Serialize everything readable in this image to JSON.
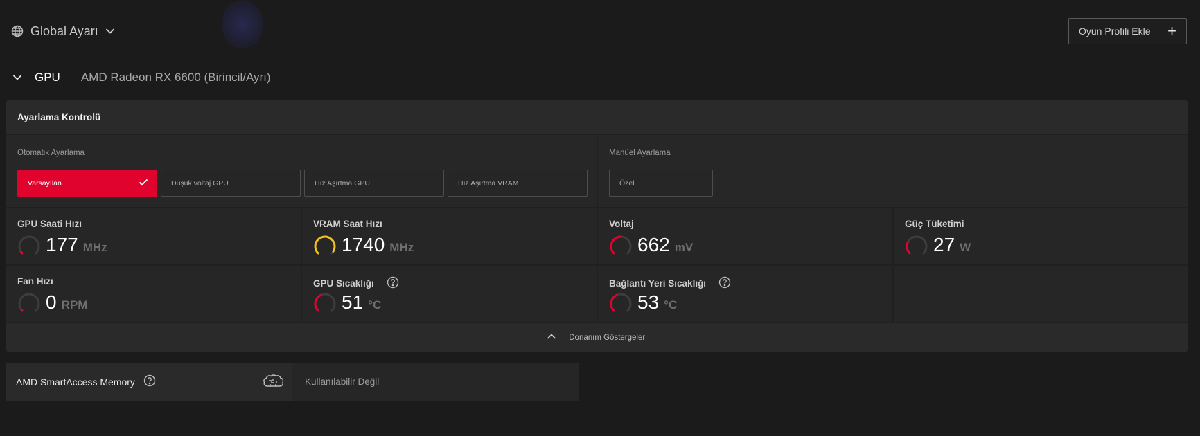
{
  "header": {
    "global_label": "Global Ayarı",
    "add_profile_label": "Oyun Profili Ekle",
    "add_profile_icon": "+"
  },
  "gpu": {
    "label": "GPU",
    "name": "AMD Radeon RX 6600 (Birincil/Ayrı)"
  },
  "tuning": {
    "title": "Ayarlama Kontrolü",
    "auto_label": "Otomatik Ayarlama",
    "manual_label": "Manüel Ayarlama",
    "auto_options": [
      "Varsayılan",
      "Düşük voltaj GPU",
      "Hız Aşırtma GPU",
      "Hız Aşırtma VRAM"
    ],
    "selected_option": "Varsayılan",
    "manual_options": [
      "Özel"
    ]
  },
  "metrics": {
    "gpu_clock": {
      "title": "GPU Saati Hızı",
      "value": "177",
      "unit": "MHz",
      "level": 0.05
    },
    "vram_clock": {
      "title": "VRAM Saat Hızı",
      "value": "1740",
      "unit": "MHz",
      "level": 0.95
    },
    "voltage": {
      "title": "Voltaj",
      "value": "662",
      "unit": "mV",
      "level": 0.5
    },
    "power": {
      "title": "Güç Tüketimi",
      "value": "27",
      "unit": "W",
      "level": 0.25
    },
    "fan": {
      "title": "Fan Hızı",
      "value": "0",
      "unit": "RPM",
      "level": 0
    },
    "gpu_temp": {
      "title": "GPU Sıcaklığı",
      "value": "51",
      "unit": "°C",
      "level": 0.4
    },
    "junction_temp": {
      "title": "Bağlantı Yeri Sıcaklığı",
      "value": "53",
      "unit": "°C",
      "level": 0.4
    }
  },
  "hardware_toggle_label": "Donanım Göstergeleri",
  "smart_access": {
    "label": "AMD SmartAccess Memory",
    "status": "Kullanılabilir Değil"
  },
  "colors": {
    "accent_red": "#e0032e",
    "gauge_yellow": "#f2c01c",
    "gauge_track": "#3d3d3d"
  }
}
